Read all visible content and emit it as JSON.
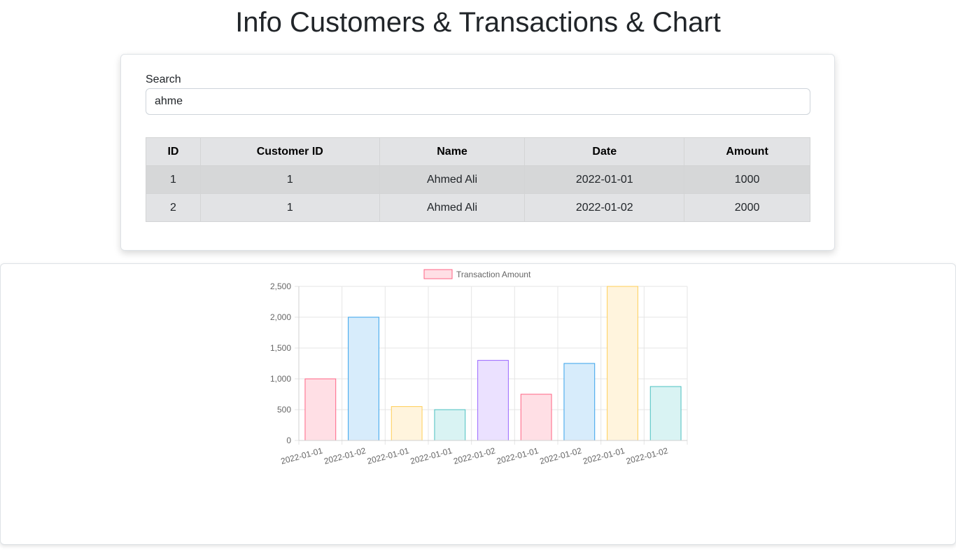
{
  "page_title": "Info Customers & Transactions & Chart",
  "search": {
    "label": "Search",
    "value": "ahme"
  },
  "table": {
    "headers": [
      "ID",
      "Customer ID",
      "Name",
      "Date",
      "Amount"
    ],
    "rows": [
      [
        "1",
        "1",
        "Ahmed Ali",
        "2022-01-01",
        "1000"
      ],
      [
        "2",
        "1",
        "Ahmed Ali",
        "2022-01-02",
        "2000"
      ]
    ]
  },
  "chart_data": {
    "type": "bar",
    "legend": "Transaction Amount",
    "legend_position": "top",
    "grid": true,
    "categories": [
      "2022-01-01",
      "2022-01-02",
      "2022-01-01",
      "2022-01-01",
      "2022-01-02",
      "2022-01-01",
      "2022-01-02",
      "2022-01-01",
      "2022-01-02"
    ],
    "values": [
      1000,
      2000,
      550,
      500,
      1300,
      750,
      1250,
      2500,
      875
    ],
    "ylim": [
      0,
      2500
    ],
    "yticks": [
      0,
      500,
      1000,
      1500,
      2000,
      2500
    ],
    "ytick_labels": [
      "0",
      "500",
      "1,000",
      "1,500",
      "2,000",
      "2,500"
    ],
    "series": [
      {
        "name": "Transaction Amount",
        "values": [
          1000,
          2000,
          550,
          500,
          1300,
          750,
          1250,
          2500,
          875
        ]
      }
    ],
    "bar_fill_colors": [
      "#ffdfe5",
      "#d7ecfb",
      "#fff4dd",
      "#d9f3f3",
      "#ebe1ff",
      "#ffdfe5",
      "#d7ecfb",
      "#fff4dd",
      "#d9f3f3"
    ],
    "bar_border_colors": [
      "#ff6384",
      "#36a2eb",
      "#ffce56",
      "#4bc0c0",
      "#9966ff",
      "#ff6384",
      "#36a2eb",
      "#ffce56",
      "#4bc0c0"
    ]
  }
}
